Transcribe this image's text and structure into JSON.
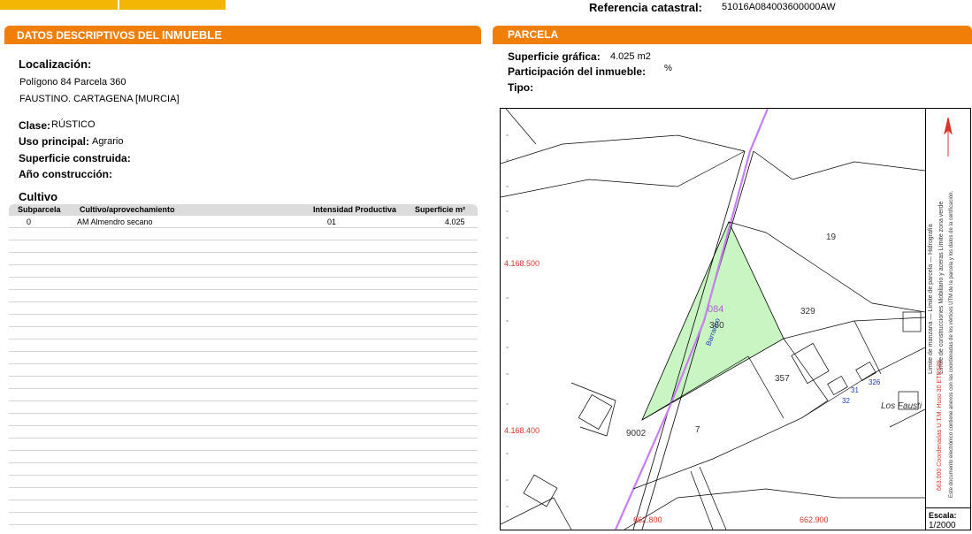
{
  "header": {
    "referencia_label": "Referencia catastral:",
    "referencia_value": "51016A084003600000AW"
  },
  "left": {
    "section_title_a": "DATOS DESCRIPTIVOS DEL ",
    "section_title_b": "INMUEBLE",
    "localizacion_label": "Localización:",
    "localizacion_line1": "Polígono 84 Parcela 360",
    "localizacion_line2": "FAUSTINO. CARTAGENA [MURCIA]",
    "clase_label": "Clase:",
    "clase_value": "RÚSTICO",
    "uso_label": "Uso principal:",
    "uso_value": "Agrario",
    "superficie_label": "Superficie construida:",
    "anio_label": "Año construcción:",
    "cultivo_title": "Cultivo",
    "table": {
      "headers": [
        "Subparcela",
        "Cultivo/aprovechamiento",
        "Intensidad Productiva",
        "Superficie m²"
      ],
      "rows": [
        [
          "0",
          "AM Almendro secano",
          "01",
          "4.025"
        ]
      ]
    }
  },
  "right": {
    "section_title": "PARCELA",
    "superficie_grafica_label": "Superficie gráfica:",
    "superficie_grafica_value": "4.025 m2",
    "participacion_label": "Participación del inmueble:",
    "participacion_value": "%",
    "tipo_label": "Tipo:",
    "map": {
      "parcel_labels": {
        "poligono": "084",
        "parcela": "360",
        "p19": "19",
        "p329": "329",
        "p357": "357",
        "p7": "7",
        "p9002": "9002",
        "barranco": "Barranco",
        "los_fausti": "Los Fausti",
        "n32": "32",
        "n31": "31",
        "n326": "326"
      },
      "coords": {
        "y1": "4.168.500",
        "y2": "4.168.400",
        "x1": "662.800",
        "x2": "662.900"
      },
      "legend": {
        "line1": "663.000 Coordenadas U.T.M. Huso 30 ETRS89",
        "line2": "Límite de manzana  —  Límite de parcela  —  Hidrografía",
        "line3": "Límite de construcciones   Mobiliario y aceras   Límite zona verde",
        "line4": "Este documento electrónico contiene anexos con las coordenadas de los vértices UTM de la parcela y los datos de la certificación."
      },
      "escala_label": "Escala:",
      "escala_value": "1/2000",
      "colors": {
        "parcel_fill": "#c9f5c2",
        "hidro": "#c77ef0",
        "coord": "#d8362a"
      }
    }
  }
}
